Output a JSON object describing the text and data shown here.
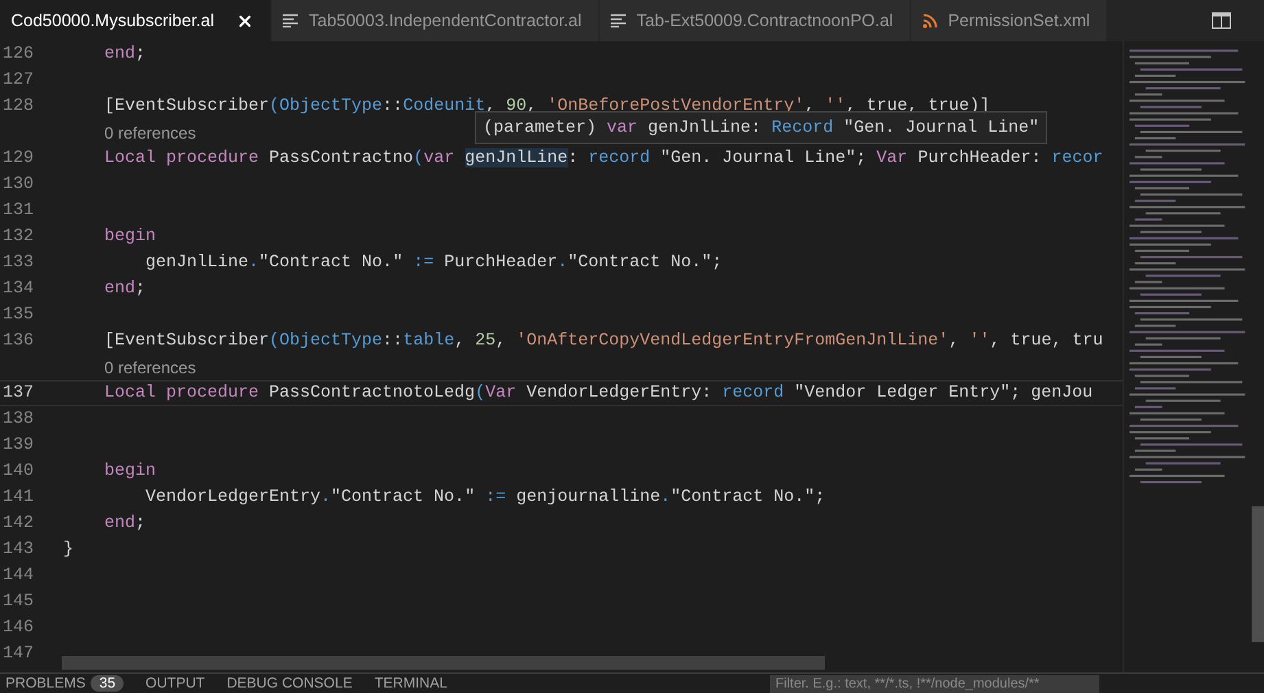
{
  "tabs": [
    {
      "label": "Cod50000.Mysubscriber.al",
      "selected": true
    },
    {
      "label": "Tab50003.IndependentContractor.al",
      "kind": "al",
      "selected": false
    },
    {
      "label": "Tab-Ext50009.ContractnoonPO.al",
      "kind": "al",
      "selected": false
    },
    {
      "label": "PermissionSet.xml",
      "kind": "xml",
      "selected": false
    }
  ],
  "editor": {
    "lines": [
      {
        "number": "126",
        "current": false,
        "tokens": [
          {
            "kind": "keyword",
            "text": "    end"
          },
          {
            "kind": "plain",
            "text": ";"
          }
        ]
      },
      {
        "number": "127",
        "current": false
      },
      {
        "number": "128",
        "current": false,
        "tokens": [
          {
            "kind": "plain",
            "text": "    [EventSubscriber"
          },
          {
            "kind": "type",
            "text": "(ObjectType"
          },
          {
            "kind": "plain",
            "text": "::"
          },
          {
            "kind": "type",
            "text": "Codeunit"
          },
          {
            "kind": "plain",
            "text": ", "
          },
          {
            "kind": "number",
            "text": "90"
          },
          {
            "kind": "plain",
            "text": ", "
          },
          {
            "kind": "string",
            "text": "'OnBeforePostVendorEntry'"
          },
          {
            "kind": "plain",
            "text": ", "
          },
          {
            "kind": "string",
            "text": "''"
          },
          {
            "kind": "plain",
            "text": ", true, true)]"
          }
        ]
      },
      {
        "number": "129",
        "current": false,
        "lens": "0 references",
        "tokens": [
          {
            "kind": "keyword",
            "text": "    Local procedure"
          },
          {
            "kind": "plain",
            "text": " PassContractno"
          },
          {
            "kind": "type",
            "text": "("
          },
          {
            "kind": "keyword",
            "text": "var "
          },
          {
            "kind": "hover",
            "text": "genJnlLine"
          },
          {
            "kind": "plain",
            "text": ": "
          },
          {
            "kind": "type",
            "text": "record"
          },
          {
            "kind": "plain",
            "text": " \"Gen. Journal Line\"; "
          },
          {
            "kind": "keyword",
            "text": "Var"
          },
          {
            "kind": "plain",
            "text": " PurchHeader: "
          },
          {
            "kind": "type",
            "text": "recor"
          }
        ]
      },
      {
        "number": "130",
        "current": false
      },
      {
        "number": "131",
        "current": false
      },
      {
        "number": "132",
        "current": false,
        "tokens": [
          {
            "kind": "keyword",
            "text": "    begin"
          }
        ]
      },
      {
        "number": "133",
        "current": false,
        "tokens": [
          {
            "kind": "plain",
            "text": "        genJnlLine"
          },
          {
            "kind": "type",
            "text": "."
          },
          {
            "kind": "plain",
            "text": "\"Contract No.\" "
          },
          {
            "kind": "type",
            "text": ":="
          },
          {
            "kind": "plain",
            "text": " PurchHeader"
          },
          {
            "kind": "type",
            "text": "."
          },
          {
            "kind": "plain",
            "text": "\"Contract No.\";"
          }
        ]
      },
      {
        "number": "134",
        "current": false,
        "tokens": [
          {
            "kind": "keyword",
            "text": "    end"
          },
          {
            "kind": "plain",
            "text": ";"
          }
        ]
      },
      {
        "number": "135",
        "current": false
      },
      {
        "number": "136",
        "current": false,
        "tokens": [
          {
            "kind": "plain",
            "text": "    [EventSubscriber"
          },
          {
            "kind": "type",
            "text": "(ObjectType"
          },
          {
            "kind": "plain",
            "text": "::"
          },
          {
            "kind": "type",
            "text": "table"
          },
          {
            "kind": "plain",
            "text": ", "
          },
          {
            "kind": "number",
            "text": "25"
          },
          {
            "kind": "plain",
            "text": ", "
          },
          {
            "kind": "string",
            "text": "'OnAfterCopyVendLedgerEntryFromGenJnlLine'"
          },
          {
            "kind": "plain",
            "text": ", "
          },
          {
            "kind": "string",
            "text": "''"
          },
          {
            "kind": "plain",
            "text": ", true, tru"
          }
        ]
      },
      {
        "number": "137",
        "current": true,
        "lens": "0 references",
        "tokens": [
          {
            "kind": "keyword",
            "text": "    Local procedure"
          },
          {
            "kind": "plain",
            "text": " PassContractnotoLedg"
          },
          {
            "kind": "type",
            "text": "("
          },
          {
            "kind": "keyword",
            "text": "Var"
          },
          {
            "kind": "plain",
            "text": " VendorLedgerEntry: "
          },
          {
            "kind": "type",
            "text": "record"
          },
          {
            "kind": "plain",
            "text": " \"Vendor Ledger Entry\"; genJou"
          }
        ]
      },
      {
        "number": "138",
        "current": false
      },
      {
        "number": "139",
        "current": false
      },
      {
        "number": "140",
        "current": false,
        "tokens": [
          {
            "kind": "keyword",
            "text": "    begin"
          }
        ]
      },
      {
        "number": "141",
        "current": false,
        "tokens": [
          {
            "kind": "plain",
            "text": "        VendorLedgerEntry"
          },
          {
            "kind": "type",
            "text": "."
          },
          {
            "kind": "plain",
            "text": "\"Contract No.\" "
          },
          {
            "kind": "type",
            "text": ":="
          },
          {
            "kind": "plain",
            "text": " genjournalline"
          },
          {
            "kind": "type",
            "text": "."
          },
          {
            "kind": "plain",
            "text": "\"Contract No.\";"
          }
        ]
      },
      {
        "number": "142",
        "current": false,
        "tokens": [
          {
            "kind": "keyword",
            "text": "    end"
          },
          {
            "kind": "plain",
            "text": ";"
          }
        ]
      },
      {
        "number": "143",
        "current": false,
        "tokens": [
          {
            "kind": "plain",
            "text": "}"
          }
        ]
      },
      {
        "number": "144",
        "current": false
      },
      {
        "number": "145",
        "current": false
      },
      {
        "number": "146",
        "current": false
      },
      {
        "number": "147",
        "current": false
      }
    ],
    "hover": {
      "tokens": [
        {
          "kind": "plain",
          "text": "(parameter) "
        },
        {
          "kind": "keyword",
          "text": "var"
        },
        {
          "kind": "plain",
          "text": " genJnlLine: "
        },
        {
          "kind": "type",
          "text": "Record"
        },
        {
          "kind": "plain",
          "text": " \"Gen. Journal Line\""
        }
      ]
    }
  },
  "panel": {
    "tabs": [
      {
        "label": "PROBLEMS",
        "badge": "35"
      },
      {
        "label": "OUTPUT"
      },
      {
        "label": "DEBUG CONSOLE"
      },
      {
        "label": "TERMINAL"
      }
    ],
    "filter": {
      "placeholder": "Filter. E.g.: text, **/*.ts, !**/node_modules/**"
    }
  }
}
